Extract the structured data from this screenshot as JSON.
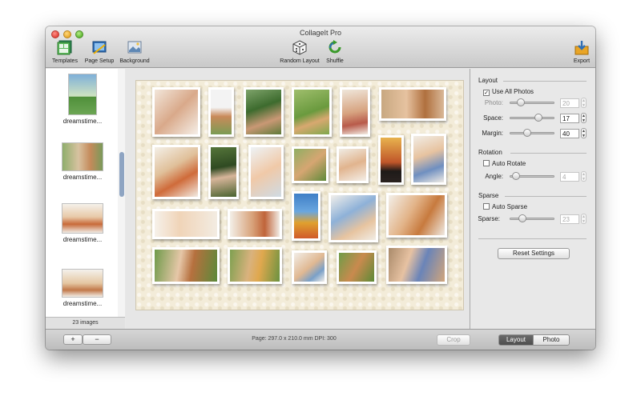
{
  "window": {
    "title": "CollageIt Pro"
  },
  "toolbar": {
    "templates": "Templates",
    "page_setup": "Page Setup",
    "background": "Background",
    "random_layout": "Random Layout",
    "shuffle": "Shuffle",
    "export": "Export"
  },
  "sidebar": {
    "items": [
      {
        "label": "dreamstime..."
      },
      {
        "label": "dreamstime..."
      },
      {
        "label": "dreamstime..."
      },
      {
        "label": "dreamstime..."
      }
    ],
    "image_count": "23 images"
  },
  "layout_panel": {
    "section_title": "Layout",
    "use_all_photos": {
      "label": "Use All Photos",
      "checked": true
    },
    "photo": {
      "label": "Photo:",
      "value": "20",
      "enabled": false
    },
    "space": {
      "label": "Space:",
      "value": "17"
    },
    "margin": {
      "label": "Margin:",
      "value": "40"
    }
  },
  "rotation_panel": {
    "section_title": "Rotation",
    "auto_rotate": {
      "label": "Auto Rotate",
      "checked": false
    },
    "angle": {
      "label": "Angle:",
      "value": "4",
      "enabled": false
    }
  },
  "sparse_panel": {
    "section_title": "Sparse",
    "auto_sparse": {
      "label": "Auto Sparse",
      "checked": false
    },
    "sparse": {
      "label": "Sparse:",
      "value": "23",
      "enabled": false
    }
  },
  "reset_button": "Reset Settings",
  "bottom": {
    "add": "+",
    "remove": "−",
    "status": "Page: 297.0 x 210.0 mm DPI: 300",
    "crop": "Crop",
    "tab_layout": "Layout",
    "tab_photo": "Photo"
  },
  "colors": {
    "page_background": "#f3ecd9",
    "segment_active": "#5f5f5f",
    "scroll_thumb": "#8ea4c2"
  }
}
